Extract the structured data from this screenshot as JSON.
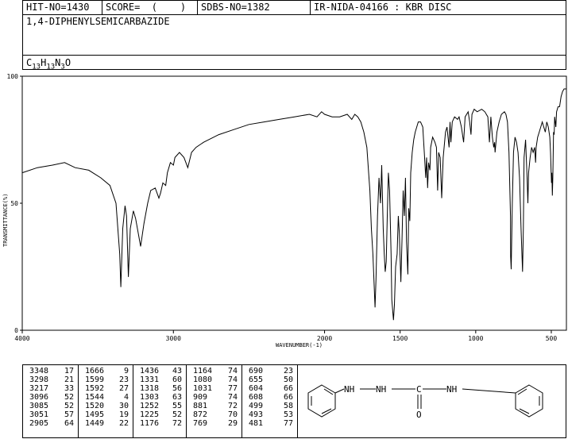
{
  "header": {
    "hit_no": "HIT-NO=1430",
    "score": "SCORE=  (    )",
    "sdbs_no": "SDBS-NO=1382",
    "ir_code": "IR-NIDA-04166 : KBR DISC",
    "compound_name": "1,4-DIPHENYLSEMICARBAZIDE",
    "formula_parts": [
      "C",
      "13",
      "H",
      "13",
      "N",
      "3",
      "O"
    ]
  },
  "chart_data": {
    "type": "line",
    "xlabel": "WAVENUMBER(-1)",
    "ylabel": "TRANSMITTANCE(%)",
    "xlim": [
      4000,
      400
    ],
    "ylim": [
      0,
      100
    ],
    "x_ticks": [
      4000,
      3000,
      2000,
      1500,
      1000,
      500
    ],
    "y_ticks": [
      0,
      50,
      100
    ],
    "line_color": "#000000",
    "points": [
      [
        4000,
        62
      ],
      [
        3900,
        64
      ],
      [
        3800,
        65
      ],
      [
        3720,
        66
      ],
      [
        3650,
        64
      ],
      [
        3560,
        63
      ],
      [
        3480,
        60
      ],
      [
        3420,
        57
      ],
      [
        3380,
        50
      ],
      [
        3355,
        30
      ],
      [
        3348,
        17
      ],
      [
        3335,
        40
      ],
      [
        3320,
        49
      ],
      [
        3310,
        45
      ],
      [
        3298,
        21
      ],
      [
        3285,
        40
      ],
      [
        3265,
        47
      ],
      [
        3250,
        44
      ],
      [
        3217,
        33
      ],
      [
        3195,
        42
      ],
      [
        3170,
        50
      ],
      [
        3150,
        55
      ],
      [
        3120,
        56
      ],
      [
        3096,
        52
      ],
      [
        3085,
        54
      ],
      [
        3070,
        58
      ],
      [
        3051,
        57
      ],
      [
        3040,
        62
      ],
      [
        3020,
        66
      ],
      [
        3000,
        65
      ],
      [
        2990,
        68
      ],
      [
        2960,
        70
      ],
      [
        2930,
        68
      ],
      [
        2905,
        64
      ],
      [
        2880,
        70
      ],
      [
        2850,
        72
      ],
      [
        2800,
        74
      ],
      [
        2700,
        77
      ],
      [
        2600,
        79
      ],
      [
        2500,
        81
      ],
      [
        2400,
        82
      ],
      [
        2300,
        83
      ],
      [
        2200,
        84
      ],
      [
        2100,
        85
      ],
      [
        2050,
        84
      ],
      [
        2020,
        86
      ],
      [
        2000,
        85
      ],
      [
        1950,
        84
      ],
      [
        1900,
        84
      ],
      [
        1850,
        85
      ],
      [
        1820,
        83
      ],
      [
        1800,
        85
      ],
      [
        1780,
        84
      ],
      [
        1760,
        82
      ],
      [
        1740,
        78
      ],
      [
        1720,
        72
      ],
      [
        1700,
        55
      ],
      [
        1690,
        40
      ],
      [
        1680,
        30
      ],
      [
        1666,
        9
      ],
      [
        1660,
        20
      ],
      [
        1650,
        45
      ],
      [
        1640,
        60
      ],
      [
        1630,
        50
      ],
      [
        1622,
        65
      ],
      [
        1612,
        40
      ],
      [
        1605,
        30
      ],
      [
        1599,
        23
      ],
      [
        1592,
        27
      ],
      [
        1585,
        45
      ],
      [
        1578,
        62
      ],
      [
        1570,
        55
      ],
      [
        1560,
        30
      ],
      [
        1555,
        12
      ],
      [
        1544,
        4
      ],
      [
        1538,
        10
      ],
      [
        1530,
        25
      ],
      [
        1520,
        30
      ],
      [
        1512,
        45
      ],
      [
        1505,
        38
      ],
      [
        1495,
        19
      ],
      [
        1488,
        35
      ],
      [
        1480,
        55
      ],
      [
        1472,
        45
      ],
      [
        1465,
        60
      ],
      [
        1458,
        35
      ],
      [
        1449,
        22
      ],
      [
        1443,
        48
      ],
      [
        1436,
        43
      ],
      [
        1430,
        62
      ],
      [
        1420,
        70
      ],
      [
        1410,
        75
      ],
      [
        1400,
        78
      ],
      [
        1390,
        80
      ],
      [
        1380,
        82
      ],
      [
        1365,
        82
      ],
      [
        1350,
        80
      ],
      [
        1340,
        70
      ],
      [
        1331,
        60
      ],
      [
        1325,
        68
      ],
      [
        1318,
        56
      ],
      [
        1312,
        66
      ],
      [
        1303,
        63
      ],
      [
        1298,
        72
      ],
      [
        1285,
        76
      ],
      [
        1270,
        74
      ],
      [
        1260,
        72
      ],
      [
        1252,
        55
      ],
      [
        1245,
        70
      ],
      [
        1235,
        68
      ],
      [
        1225,
        52
      ],
      [
        1215,
        68
      ],
      [
        1200,
        78
      ],
      [
        1190,
        80
      ],
      [
        1176,
        72
      ],
      [
        1170,
        82
      ],
      [
        1164,
        74
      ],
      [
        1155,
        82
      ],
      [
        1140,
        84
      ],
      [
        1120,
        83
      ],
      [
        1110,
        84
      ],
      [
        1095,
        80
      ],
      [
        1080,
        74
      ],
      [
        1070,
        84
      ],
      [
        1050,
        86
      ],
      [
        1040,
        82
      ],
      [
        1031,
        77
      ],
      [
        1025,
        85
      ],
      [
        1010,
        87
      ],
      [
        990,
        86
      ],
      [
        960,
        87
      ],
      [
        940,
        86
      ],
      [
        920,
        84
      ],
      [
        909,
        74
      ],
      [
        900,
        84
      ],
      [
        890,
        76
      ],
      [
        881,
        72
      ],
      [
        875,
        74
      ],
      [
        872,
        70
      ],
      [
        860,
        78
      ],
      [
        845,
        82
      ],
      [
        830,
        85
      ],
      [
        810,
        86
      ],
      [
        800,
        85
      ],
      [
        790,
        82
      ],
      [
        780,
        70
      ],
      [
        770,
        45
      ],
      [
        769,
        29
      ],
      [
        765,
        24
      ],
      [
        758,
        50
      ],
      [
        750,
        70
      ],
      [
        740,
        76
      ],
      [
        730,
        74
      ],
      [
        720,
        70
      ],
      [
        710,
        60
      ],
      [
        700,
        40
      ],
      [
        690,
        23
      ],
      [
        685,
        40
      ],
      [
        680,
        68
      ],
      [
        670,
        75
      ],
      [
        660,
        60
      ],
      [
        655,
        50
      ],
      [
        650,
        62
      ],
      [
        640,
        68
      ],
      [
        630,
        72
      ],
      [
        620,
        70
      ],
      [
        610,
        72
      ],
      [
        604,
        66
      ],
      [
        600,
        72
      ],
      [
        590,
        76
      ],
      [
        580,
        78
      ],
      [
        570,
        80
      ],
      [
        560,
        82
      ],
      [
        550,
        80
      ],
      [
        540,
        78
      ],
      [
        530,
        82
      ],
      [
        520,
        80
      ],
      [
        510,
        76
      ],
      [
        505,
        70
      ],
      [
        499,
        58
      ],
      [
        496,
        62
      ],
      [
        493,
        53
      ],
      [
        490,
        60
      ],
      [
        485,
        78
      ],
      [
        481,
        77
      ],
      [
        478,
        84
      ],
      [
        470,
        80
      ],
      [
        465,
        86
      ],
      [
        455,
        88
      ],
      [
        445,
        88
      ],
      [
        435,
        92
      ],
      [
        425,
        94
      ],
      [
        415,
        95
      ],
      [
        400,
        95
      ]
    ],
    "peak_table": [
      {
        "wavenumber": 3348,
        "transmittance": 17
      },
      {
        "wavenumber": 3298,
        "transmittance": 21
      },
      {
        "wavenumber": 3217,
        "transmittance": 33
      },
      {
        "wavenumber": 3096,
        "transmittance": 52
      },
      {
        "wavenumber": 3085,
        "transmittance": 52
      },
      {
        "wavenumber": 3051,
        "transmittance": 57
      },
      {
        "wavenumber": 2905,
        "transmittance": 64
      },
      {
        "wavenumber": 1666,
        "transmittance": 9
      },
      {
        "wavenumber": 1599,
        "transmittance": 23
      },
      {
        "wavenumber": 1592,
        "transmittance": 27
      },
      {
        "wavenumber": 1544,
        "transmittance": 4
      },
      {
        "wavenumber": 1520,
        "transmittance": 30
      },
      {
        "wavenumber": 1495,
        "transmittance": 19
      },
      {
        "wavenumber": 1449,
        "transmittance": 22
      },
      {
        "wavenumber": 1436,
        "transmittance": 43
      },
      {
        "wavenumber": 1331,
        "transmittance": 60
      },
      {
        "wavenumber": 1318,
        "transmittance": 56
      },
      {
        "wavenumber": 1303,
        "transmittance": 63
      },
      {
        "wavenumber": 1252,
        "transmittance": 55
      },
      {
        "wavenumber": 1225,
        "transmittance": 52
      },
      {
        "wavenumber": 1176,
        "transmittance": 72
      },
      {
        "wavenumber": 1164,
        "transmittance": 74
      },
      {
        "wavenumber": 1080,
        "transmittance": 74
      },
      {
        "wavenumber": 1031,
        "transmittance": 77
      },
      {
        "wavenumber": 909,
        "transmittance": 74
      },
      {
        "wavenumber": 881,
        "transmittance": 72
      },
      {
        "wavenumber": 872,
        "transmittance": 70
      },
      {
        "wavenumber": 769,
        "transmittance": 29
      },
      {
        "wavenumber": 690,
        "transmittance": 23
      },
      {
        "wavenumber": 655,
        "transmittance": 50
      },
      {
        "wavenumber": 604,
        "transmittance": 66
      },
      {
        "wavenumber": 608,
        "transmittance": 66
      },
      {
        "wavenumber": 499,
        "transmittance": 58
      },
      {
        "wavenumber": 493,
        "transmittance": 53
      },
      {
        "wavenumber": 481,
        "transmittance": 77
      }
    ]
  },
  "structure_labels": {
    "nh1": "NH",
    "nh2": "NH",
    "c": "C",
    "nh3": "NH",
    "o": "O"
  }
}
